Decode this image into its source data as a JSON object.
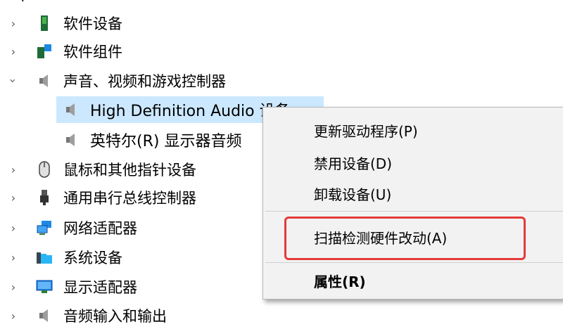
{
  "tree": {
    "top_partial": "?",
    "items": [
      {
        "label": "软件设备",
        "icon": "software-device-icon",
        "expanded": false
      },
      {
        "label": "软件组件",
        "icon": "software-component-icon",
        "expanded": false
      },
      {
        "label": "声音、视频和游戏控制器",
        "icon": "speaker-icon",
        "expanded": true
      },
      {
        "label": "High Definition Audio 设备",
        "icon": "speaker-icon",
        "child": true,
        "selected": true
      },
      {
        "label": "英特尔(R) 显示器音频",
        "icon": "speaker-icon",
        "child": true
      },
      {
        "label": "鼠标和其他指针设备",
        "icon": "mouse-icon",
        "expanded": false
      },
      {
        "label": "通用串行总线控制器",
        "icon": "usb-icon",
        "expanded": false
      },
      {
        "label": "网络适配器",
        "icon": "network-icon",
        "expanded": false
      },
      {
        "label": "系统设备",
        "icon": "system-folder-icon",
        "expanded": false
      },
      {
        "label": "显示适配器",
        "icon": "monitor-icon",
        "expanded": false
      },
      {
        "label": "音频输入和输出",
        "icon": "speaker-icon",
        "expanded": false
      }
    ]
  },
  "context_menu": {
    "items": [
      {
        "label": "更新驱动程序(P)"
      },
      {
        "label": "禁用设备(D)"
      },
      {
        "label": "卸载设备(U)"
      },
      {
        "label": "扫描检测硬件改动(A)",
        "highlighted": true
      },
      {
        "label": "属性(R)",
        "bold": true
      }
    ]
  },
  "colors": {
    "selection": "#cce8ff",
    "highlight_border": "#e53a3a",
    "menu_bg": "#f2f2f2"
  }
}
